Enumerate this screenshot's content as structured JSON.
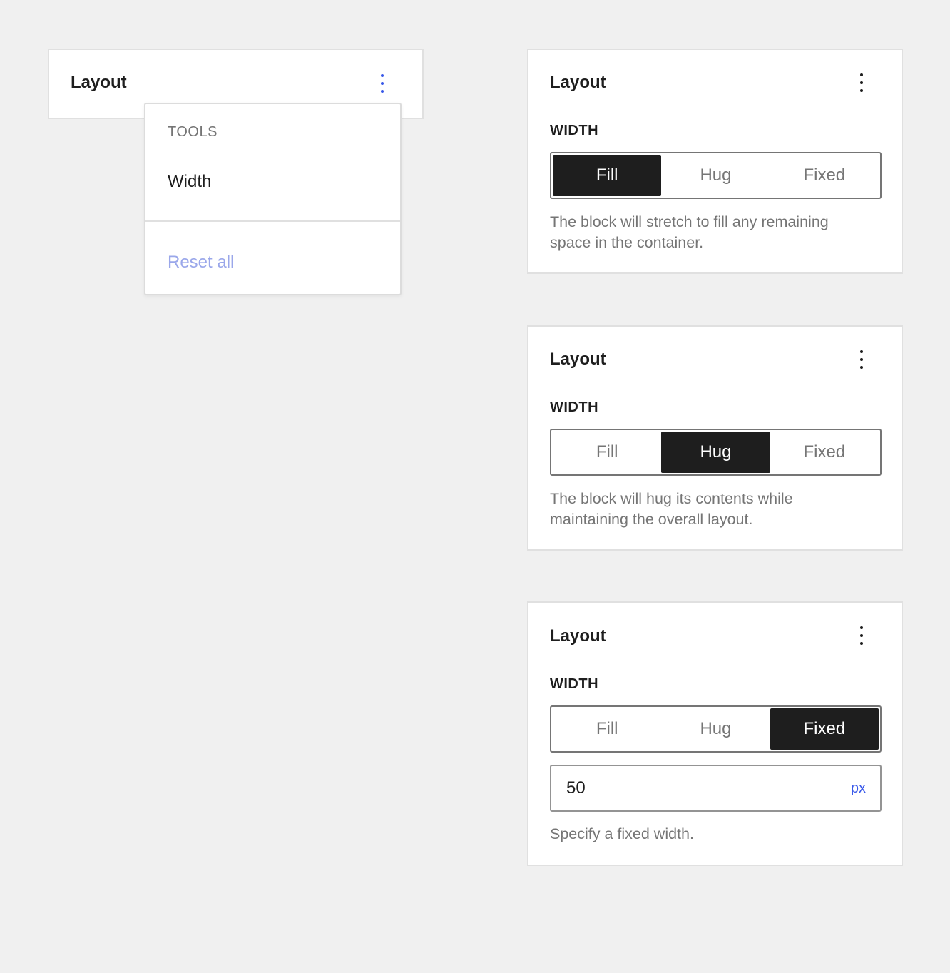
{
  "colors": {
    "background": "#f0f0f0",
    "panel": "#ffffff",
    "selected_segment": "#1e1e1e",
    "accent": "#3858e9",
    "disabled_accent": "#9aa7ea",
    "muted_text": "#757575"
  },
  "collapsed_panel": {
    "title": "Layout",
    "menu_icon": "vertical-ellipsis-icon",
    "menu": {
      "heading": "TOOLS",
      "item": "Width",
      "reset": "Reset all"
    }
  },
  "panels": [
    {
      "title": "Layout",
      "menu_icon": "vertical-ellipsis-icon",
      "section_label": "WIDTH",
      "options": [
        "Fill",
        "Hug",
        "Fixed"
      ],
      "selected": "Fill",
      "help": "The block will stretch to fill any remaining space in the container."
    },
    {
      "title": "Layout",
      "menu_icon": "vertical-ellipsis-icon",
      "section_label": "WIDTH",
      "options": [
        "Fill",
        "Hug",
        "Fixed"
      ],
      "selected": "Hug",
      "help": "The block will hug its contents while maintaining the overall layout."
    },
    {
      "title": "Layout",
      "menu_icon": "vertical-ellipsis-icon",
      "section_label": "WIDTH",
      "options": [
        "Fill",
        "Hug",
        "Fixed"
      ],
      "selected": "Fixed",
      "input": {
        "value": "50",
        "unit": "px"
      },
      "help": "Specify a fixed width."
    }
  ]
}
